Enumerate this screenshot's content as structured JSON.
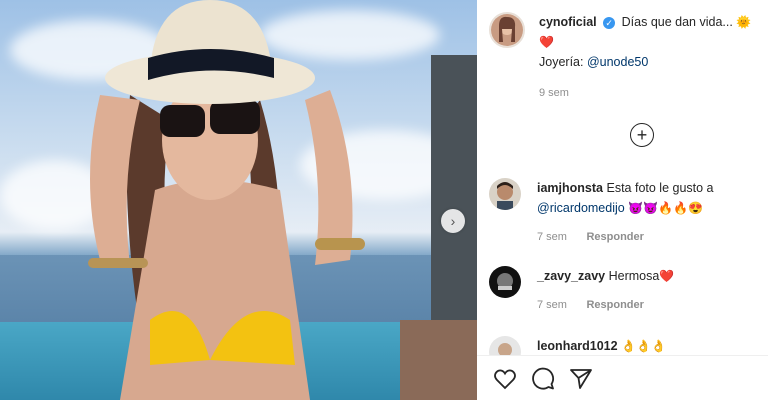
{
  "post": {
    "username": "cynoficial",
    "caption": "Días que dan vida...",
    "caption_emoji_sun": "🌞",
    "caption_emoji_heart": "❤️",
    "jewelry_label": "Joyería:",
    "jewelry_mention": "@unode50",
    "time": "9 sem"
  },
  "comments": [
    {
      "username": "iamjhonsta",
      "text": "Esta foto le gusto a",
      "mention": "@ricardomedijo",
      "emojis": "😈😈🔥🔥😍",
      "time": "7 sem",
      "reply": "Responder"
    },
    {
      "username": "_zavy_zavy",
      "text": "Hermosa",
      "emojis": "❤️",
      "time": "7 sem",
      "reply": "Responder"
    },
    {
      "username": "leonhard1012",
      "text": "",
      "emojis": "👌👌👌"
    }
  ],
  "icons": {
    "like": "heart-icon",
    "comment": "comment-icon",
    "share": "paper-plane-icon",
    "load_more": "plus-circle-icon",
    "carousel": "chevron-right-icon"
  },
  "colors": {
    "verified": "#3897f0",
    "mention": "#00376b",
    "muted": "#8e8e8e"
  }
}
